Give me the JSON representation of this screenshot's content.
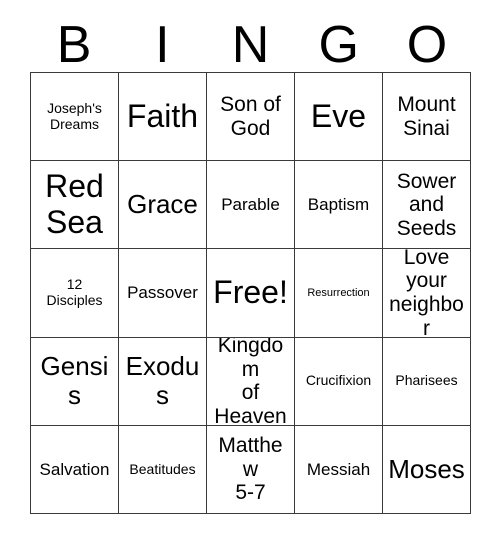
{
  "card": {
    "header_letters": [
      "B",
      "I",
      "N",
      "G",
      "O"
    ],
    "rows": [
      [
        {
          "text": "Joseph's\nDreams",
          "size": "fs-sm",
          "name": "bingo-cell-josephs-dreams"
        },
        {
          "text": "Faith",
          "size": "fs-xxl",
          "name": "bingo-cell-faith"
        },
        {
          "text": "Son of\nGod",
          "size": "fs-lg",
          "name": "bingo-cell-son-of-god"
        },
        {
          "text": "Eve",
          "size": "fs-xxl",
          "name": "bingo-cell-eve"
        },
        {
          "text": "Mount\nSinai",
          "size": "fs-lg",
          "name": "bingo-cell-mount-sinai"
        }
      ],
      [
        {
          "text": "Red\nSea",
          "size": "fs-xxl",
          "name": "bingo-cell-red-sea"
        },
        {
          "text": "Grace",
          "size": "fs-xl",
          "name": "bingo-cell-grace"
        },
        {
          "text": "Parable",
          "size": "fs-md",
          "name": "bingo-cell-parable"
        },
        {
          "text": "Baptism",
          "size": "fs-md",
          "name": "bingo-cell-baptism"
        },
        {
          "text": "Sower\nand\nSeeds",
          "size": "fs-lg",
          "name": "bingo-cell-sower-and-seeds"
        }
      ],
      [
        {
          "text": "12\nDisciples",
          "size": "fs-sm",
          "name": "bingo-cell-12-disciples"
        },
        {
          "text": "Passover",
          "size": "fs-md",
          "name": "bingo-cell-passover"
        },
        {
          "text": "Free!",
          "size": "fs-xxl",
          "name": "bingo-cell-free-space"
        },
        {
          "text": "Resurrection",
          "size": "fs-xs",
          "name": "bingo-cell-resurrection"
        },
        {
          "text": "Love\nyour\nneighbor",
          "size": "fs-lg",
          "name": "bingo-cell-love-your-neighbor"
        }
      ],
      [
        {
          "text": "Gensis",
          "size": "fs-xl",
          "name": "bingo-cell-gensis"
        },
        {
          "text": "Exodus",
          "size": "fs-xl",
          "name": "bingo-cell-exodus"
        },
        {
          "text": "Kingdom\nof\nHeaven",
          "size": "fs-lg",
          "name": "bingo-cell-kingdom-of-heaven"
        },
        {
          "text": "Crucifixion",
          "size": "fs-sm",
          "name": "bingo-cell-crucifixion"
        },
        {
          "text": "Pharisees",
          "size": "fs-sm",
          "name": "bingo-cell-pharisees"
        }
      ],
      [
        {
          "text": "Salvation",
          "size": "fs-md",
          "name": "bingo-cell-salvation"
        },
        {
          "text": "Beatitudes",
          "size": "fs-sm",
          "name": "bingo-cell-beatitudes"
        },
        {
          "text": "Matthew\n5-7",
          "size": "fs-lg",
          "name": "bingo-cell-matthew-5-7"
        },
        {
          "text": "Messiah",
          "size": "fs-md",
          "name": "bingo-cell-messiah"
        },
        {
          "text": "Moses",
          "size": "fs-xl",
          "name": "bingo-cell-moses"
        }
      ]
    ],
    "colors": {
      "background": "#ffffff",
      "text": "#000000",
      "border": "#3a3a3a"
    }
  }
}
